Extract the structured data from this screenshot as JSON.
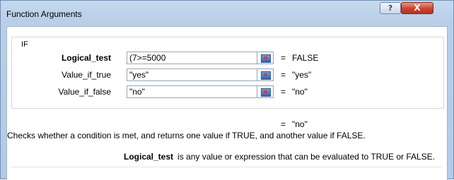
{
  "window": {
    "title": "Function Arguments",
    "help_glyph": "?",
    "close_glyph": "X"
  },
  "function_name": "IF",
  "arguments": [
    {
      "label": "Logical_test",
      "value": "(7>=5000",
      "result": "FALSE"
    },
    {
      "label": "Value_if_true",
      "value": "\"yes\"",
      "result": "\"yes\""
    },
    {
      "label": "Value_if_false",
      "value": "\"no\"",
      "result": "\"no\""
    }
  ],
  "equals_sign": "=",
  "formula_result": "\"no\"",
  "description": "Checks whether a condition is met, and returns one value if TRUE, and another value if FALSE.",
  "argument_help": {
    "name": "Logical_test",
    "text": "is any value or expression that can be evaluated to TRUE or FALSE."
  }
}
